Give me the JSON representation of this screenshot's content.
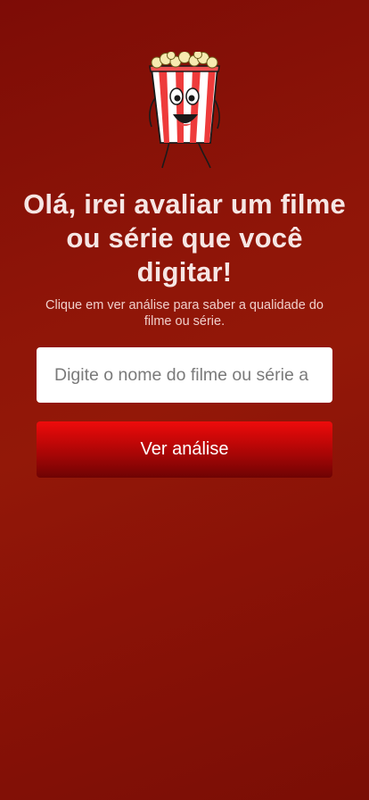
{
  "hero": {
    "mascot_icon": "popcorn-bucket-mascot-icon",
    "headline": "Olá, irei avaliar um filme ou série que você digitar!",
    "subtitle": "Clique em ver análise para saber a qualidade do filme ou série."
  },
  "search": {
    "placeholder": "Digite o nome do filme ou série a",
    "value": ""
  },
  "actions": {
    "submit_label": "Ver análise"
  },
  "colors": {
    "background": "#8f1508",
    "button_top": "#ee0c0c",
    "button_bottom": "#6e0303",
    "headline_text": "#f6e6e4"
  }
}
